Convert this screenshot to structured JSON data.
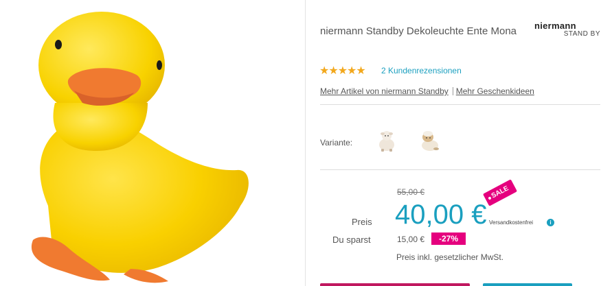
{
  "product": {
    "title": "niermann Standby Dekoleuchte Ente Mona",
    "image_alt": "yellow-duck-lamp"
  },
  "brand": {
    "logo_top": "niermann",
    "logo_bottom": "STAND BY"
  },
  "rating": {
    "stars_text": "★★★★★",
    "value": 5,
    "max": 5,
    "reviews_label": "2 Kundenrezensionen"
  },
  "links": {
    "more_brand": "Mehr Artikel von niermann Standby",
    "more_gifts": "Mehr Geschenkideen"
  },
  "variants": {
    "label": "Variante:",
    "items": [
      "sheep-figurine-white",
      "sheep-figurine-cream"
    ]
  },
  "pricing": {
    "old_price": "55,00 €",
    "price_label": "Preis",
    "price": "40,00 €",
    "shipping": "Versandkostenfrei",
    "sale_tag": "SALE",
    "save_label": "Du sparst",
    "save_amount": "15,00 €",
    "discount": "-27%",
    "tax_note": "Preis inkl. gesetzlicher MwSt."
  },
  "colors": {
    "accent": "#1a9fbf",
    "sale": "#e5007e",
    "star": "#f2a81d",
    "cta_primary": "#c0185f"
  },
  "icons": {
    "info": "info-icon",
    "info_glyph": "i"
  }
}
